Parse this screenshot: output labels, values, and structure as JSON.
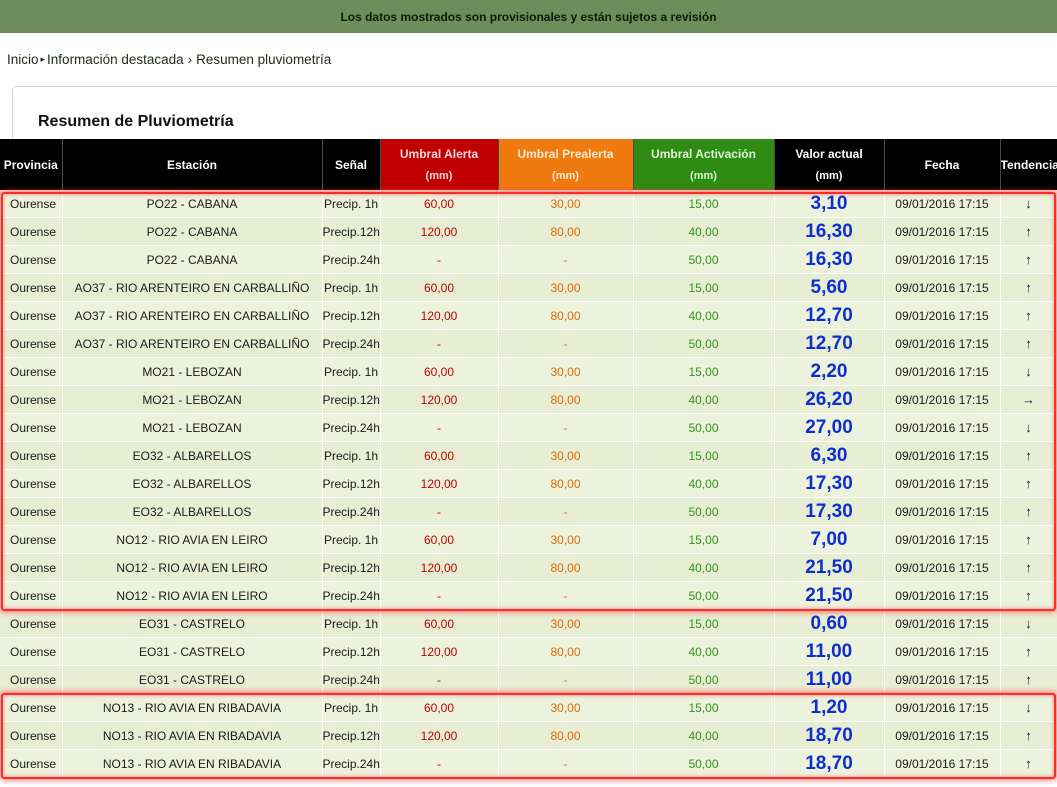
{
  "banner": {
    "text": "Los datos mostrados son provisionales y están sujetos a revisión"
  },
  "breadcrumb": {
    "home": "Inicio",
    "section": "Información destacada",
    "sep": "›",
    "page": "Resumen pluviometría"
  },
  "page": {
    "title": "Resumen de Pluviometría"
  },
  "table": {
    "headers": {
      "provincia": "Provincia",
      "estacion": "Estación",
      "senal": "Señal",
      "alerta": "Umbral Alerta",
      "prealerta": "Umbral Prealerta",
      "activacion": "Umbral Activación",
      "valor": "Valor actual",
      "unit": "(mm)",
      "fecha": "Fecha",
      "tendencia": "Tendencia"
    },
    "colors": {
      "alerta": "#c00000",
      "prealerta": "#ef7a10",
      "activacion": "#2e8b14",
      "valor": "#0e2fd0",
      "highlight": "#ff2a2a"
    },
    "trend_icons": {
      "up": "arrow-up-icon",
      "down": "arrow-down-icon",
      "right": "arrow-right-icon"
    },
    "rows": [
      {
        "provincia": "Ourense",
        "estacion": "PO22 - CABANA",
        "senal": "Precip. 1h",
        "alerta": "60,00",
        "prealerta": "30,00",
        "activacion": "15,00",
        "valor": "3,10",
        "fecha": "09/01/2016 17:15",
        "tendencia": "↓",
        "trend_name": "arrow-down-icon"
      },
      {
        "provincia": "Ourense",
        "estacion": "PO22 - CABANA",
        "senal": "Precip.12h",
        "alerta": "120,00",
        "prealerta": "80,00",
        "activacion": "40,00",
        "valor": "16,30",
        "fecha": "09/01/2016 17:15",
        "tendencia": "↑",
        "trend_name": "arrow-up-icon"
      },
      {
        "provincia": "Ourense",
        "estacion": "PO22 - CABANA",
        "senal": "Precip.24h",
        "alerta": "-",
        "prealerta": "-",
        "activacion": "50,00",
        "valor": "16,30",
        "fecha": "09/01/2016 17:15",
        "tendencia": "↑",
        "trend_name": "arrow-up-icon"
      },
      {
        "provincia": "Ourense",
        "estacion": "AO37 - RIO ARENTEIRO EN CARBALLIÑO",
        "senal": "Precip. 1h",
        "alerta": "60,00",
        "prealerta": "30,00",
        "activacion": "15,00",
        "valor": "5,60",
        "fecha": "09/01/2016 17:15",
        "tendencia": "↑",
        "trend_name": "arrow-up-icon"
      },
      {
        "provincia": "Ourense",
        "estacion": "AO37 - RIO ARENTEIRO EN CARBALLIÑO",
        "senal": "Precip.12h",
        "alerta": "120,00",
        "prealerta": "80,00",
        "activacion": "40,00",
        "valor": "12,70",
        "fecha": "09/01/2016 17:15",
        "tendencia": "↑",
        "trend_name": "arrow-up-icon"
      },
      {
        "provincia": "Ourense",
        "estacion": "AO37 - RIO ARENTEIRO EN CARBALLIÑO",
        "senal": "Precip.24h",
        "alerta": "-",
        "prealerta": "-",
        "activacion": "50,00",
        "valor": "12,70",
        "fecha": "09/01/2016 17:15",
        "tendencia": "↑",
        "trend_name": "arrow-up-icon"
      },
      {
        "provincia": "Ourense",
        "estacion": "MO21 - LEBOZAN",
        "senal": "Precip. 1h",
        "alerta": "60,00",
        "prealerta": "30,00",
        "activacion": "15,00",
        "valor": "2,20",
        "fecha": "09/01/2016 17:15",
        "tendencia": "↓",
        "trend_name": "arrow-down-icon"
      },
      {
        "provincia": "Ourense",
        "estacion": "MO21 - LEBOZAN",
        "senal": "Precip.12h",
        "alerta": "120,00",
        "prealerta": "80,00",
        "activacion": "40,00",
        "valor": "26,20",
        "fecha": "09/01/2016 17:15",
        "tendencia": "→",
        "trend_name": "arrow-right-icon"
      },
      {
        "provincia": "Ourense",
        "estacion": "MO21 - LEBOZAN",
        "senal": "Precip.24h",
        "alerta": "-",
        "prealerta": "-",
        "activacion": "50,00",
        "valor": "27,00",
        "fecha": "09/01/2016 17:15",
        "tendencia": "↓",
        "trend_name": "arrow-down-icon"
      },
      {
        "provincia": "Ourense",
        "estacion": "EO32 - ALBARELLOS",
        "senal": "Precip. 1h",
        "alerta": "60,00",
        "prealerta": "30,00",
        "activacion": "15,00",
        "valor": "6,30",
        "fecha": "09/01/2016 17:15",
        "tendencia": "↑",
        "trend_name": "arrow-up-icon"
      },
      {
        "provincia": "Ourense",
        "estacion": "EO32 - ALBARELLOS",
        "senal": "Precip.12h",
        "alerta": "120,00",
        "prealerta": "80,00",
        "activacion": "40,00",
        "valor": "17,30",
        "fecha": "09/01/2016 17:15",
        "tendencia": "↑",
        "trend_name": "arrow-up-icon"
      },
      {
        "provincia": "Ourense",
        "estacion": "EO32 - ALBARELLOS",
        "senal": "Precip.24h",
        "alerta": "-",
        "prealerta": "-",
        "activacion": "50,00",
        "valor": "17,30",
        "fecha": "09/01/2016 17:15",
        "tendencia": "↑",
        "trend_name": "arrow-up-icon"
      },
      {
        "provincia": "Ourense",
        "estacion": "NO12 - RIO AVIA EN LEIRO",
        "senal": "Precip. 1h",
        "alerta": "60,00",
        "prealerta": "30,00",
        "activacion": "15,00",
        "valor": "7,00",
        "fecha": "09/01/2016 17:15",
        "tendencia": "↑",
        "trend_name": "arrow-up-icon"
      },
      {
        "provincia": "Ourense",
        "estacion": "NO12 - RIO AVIA EN LEIRO",
        "senal": "Precip.12h",
        "alerta": "120,00",
        "prealerta": "80,00",
        "activacion": "40,00",
        "valor": "21,50",
        "fecha": "09/01/2016 17:15",
        "tendencia": "↑",
        "trend_name": "arrow-up-icon"
      },
      {
        "provincia": "Ourense",
        "estacion": "NO12 - RIO AVIA EN LEIRO",
        "senal": "Precip.24h",
        "alerta": "-",
        "prealerta": "-",
        "activacion": "50,00",
        "valor": "21,50",
        "fecha": "09/01/2016 17:15",
        "tendencia": "↑",
        "trend_name": "arrow-up-icon"
      },
      {
        "provincia": "Ourense",
        "estacion": "EO31 - CASTRELO",
        "senal": "Precip. 1h",
        "alerta": "60,00",
        "prealerta": "30,00",
        "activacion": "15,00",
        "valor": "0,60",
        "fecha": "09/01/2016 17:15",
        "tendencia": "↓",
        "trend_name": "arrow-down-icon"
      },
      {
        "provincia": "Ourense",
        "estacion": "EO31 - CASTRELO",
        "senal": "Precip.12h",
        "alerta": "120,00",
        "prealerta": "80,00",
        "activacion": "40,00",
        "valor": "11,00",
        "fecha": "09/01/2016 17:15",
        "tendencia": "↑",
        "trend_name": "arrow-up-icon"
      },
      {
        "provincia": "Ourense",
        "estacion": "EO31 - CASTRELO",
        "senal": "Precip.24h",
        "alerta": "-",
        "prealerta": "-",
        "activacion": "50,00",
        "valor": "11,00",
        "fecha": "09/01/2016 17:15",
        "tendencia": "↑",
        "trend_name": "arrow-up-icon"
      },
      {
        "provincia": "Ourense",
        "estacion": "NO13 - RIO AVIA EN RIBADAVIA",
        "senal": "Precip. 1h",
        "alerta": "60,00",
        "prealerta": "30,00",
        "activacion": "15,00",
        "valor": "1,20",
        "fecha": "09/01/2016 17:15",
        "tendencia": "↓",
        "trend_name": "arrow-down-icon"
      },
      {
        "provincia": "Ourense",
        "estacion": "NO13 - RIO AVIA EN RIBADAVIA",
        "senal": "Precip.12h",
        "alerta": "120,00",
        "prealerta": "80,00",
        "activacion": "40,00",
        "valor": "18,70",
        "fecha": "09/01/2016 17:15",
        "tendencia": "↑",
        "trend_name": "arrow-up-icon"
      },
      {
        "provincia": "Ourense",
        "estacion": "NO13 - RIO AVIA EN RIBADAVIA",
        "senal": "Precip.24h",
        "alerta": "-",
        "prealerta": "-",
        "activacion": "50,00",
        "valor": "18,70",
        "fecha": "09/01/2016 17:15",
        "tendencia": "↑",
        "trend_name": "arrow-up-icon"
      }
    ]
  }
}
